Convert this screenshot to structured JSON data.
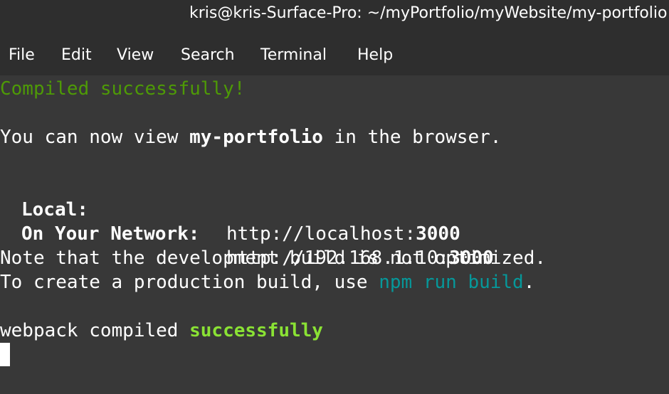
{
  "window": {
    "title": "kris@kris-Surface-Pro: ~/myPortfolio/myWebsite/my-portfolio"
  },
  "menu": {
    "file": "File",
    "edit": "Edit",
    "view": "View",
    "search": "Search",
    "terminal": "Terminal",
    "help": "Help"
  },
  "terminal": {
    "compiled": "Compiled successfully!",
    "view_prefix": "You can now view ",
    "app_name": "my-portfolio",
    "view_suffix": " in the browser.",
    "local_label": "Local:",
    "local_url": "http://localhost:",
    "local_port": "3000",
    "network_label": "On Your Network:",
    "network_url": "http://192.168.1.10:",
    "network_port": "3000",
    "note": "Note that the development build is not optimized.",
    "prod_prefix": "To create a production build, use ",
    "prod_cmd": "npm run build",
    "prod_suffix": ".",
    "webpack_prefix": "webpack compiled ",
    "webpack_status": "successfully"
  },
  "colors": {
    "background": "#383838",
    "chrome": "#2e2e2e",
    "success_green": "#4e9a06",
    "bright_green": "#8ae234",
    "command_cyan": "#06989a"
  }
}
